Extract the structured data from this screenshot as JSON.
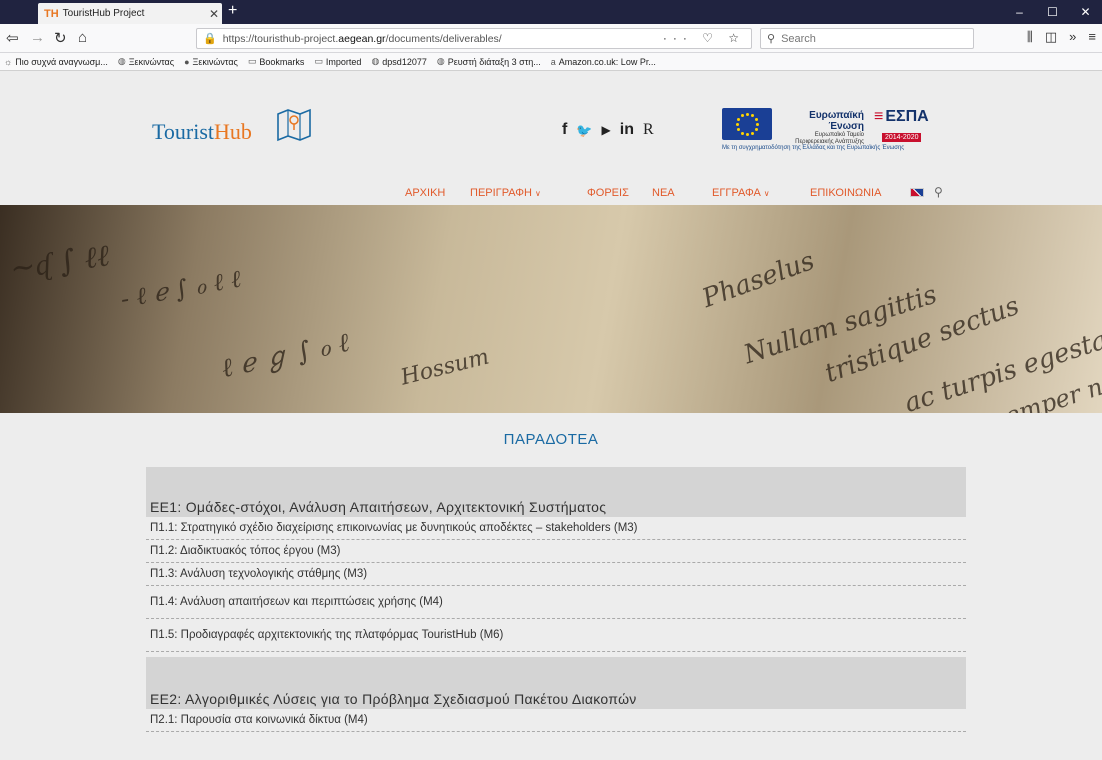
{
  "browser": {
    "tab_title": "TouristHub Project",
    "tab_icon_text": "TH",
    "url_prefix": "https://touristhub-project.",
    "url_host": "aegean.gr",
    "url_path": "/documents/deliverables/",
    "url_actions": "··· ♡ ☆",
    "search_placeholder": "Search",
    "bookmarks": [
      {
        "label": "Πιο συχνά αναγνωσμ...",
        "icon": "gear-icon"
      },
      {
        "label": "Ξεκινώντας",
        "icon": "globe-icon"
      },
      {
        "label": "Ξεκινώντας",
        "icon": "firefox-icon"
      },
      {
        "label": "Bookmarks",
        "icon": "folder-icon"
      },
      {
        "label": "Imported",
        "icon": "folder-icon"
      },
      {
        "label": "dpsd12077",
        "icon": "globe-icon"
      },
      {
        "label": "Ρευστή διάταξη 3 στη...",
        "icon": "globe-icon"
      },
      {
        "label": "Amazon.co.uk: Low Pr...",
        "icon": "amazon-icon"
      }
    ]
  },
  "site": {
    "logo_tourist": "Tourist",
    "logo_hub": "Hub",
    "social": [
      "f",
      "🐦",
      "▶",
      "in",
      "R"
    ],
    "eu_title": "Ευρωπαϊκή Ένωση",
    "eu_sub1": "Ευρωπαϊκό Ταμείο",
    "eu_sub2": "Περιφερειακής Ανάπτυξης",
    "espa_label": "ΕΣΠΑ",
    "espa_years": "2014-2020",
    "cofund_text": "Με τη συγχρηματοδότηση της Ελλάδας και της Ευρωπαϊκής Ένωσης",
    "nav": [
      {
        "label": "ΑΡΧΙΚΗ",
        "dropdown": false
      },
      {
        "label": "ΠΕΡΙΓΡΑΦΗ",
        "dropdown": true
      },
      {
        "label": "ΦΟΡΕΙΣ",
        "dropdown": false
      },
      {
        "label": "ΝΕΑ",
        "dropdown": false
      },
      {
        "label": "ΕΓΓΡΑΦΑ",
        "dropdown": true
      },
      {
        "label": "ΕΠΙΚΟΙΝΩΝΙΑ",
        "dropdown": false
      }
    ],
    "hero_script": [
      "Phaselus",
      "tristique sectus",
      "ac turpis egestas",
      "Nullam sagittis",
      "et semper nec",
      "Hossum"
    ],
    "page_title": "ΠΑΡΑΔΟΤΕΑ",
    "work_packages": [
      {
        "title": "ΕΕ1: Ομάδες-στόχοι, Ανάλυση Απαιτήσεων, Αρχιτεκτονική Συστήματος",
        "deliverables": [
          "Π1.1: Στρατηγικό σχέδιο διαχείρισης επικοινωνίας με δυνητικούς αποδέκτες – stakeholders (Μ3)",
          "Π1.2: Διαδικτυακός τόπος έργου (Μ3)",
          "Π1.3: Ανάλυση τεχνολογικής στάθμης (Μ3)",
          "Π1.4: Ανάλυση απαιτήσεων και περιπτώσεις χρήσης (Μ4)",
          "Π1.5: Προδιαγραφές αρχιτεκτονικής της πλατφόρμας TouristHub (Μ6)"
        ]
      },
      {
        "title": "ΕΕ2: Αλγοριθμικές Λύσεις για το Πρόβλημα Σχεδιασμού Πακέτου Διακοπών",
        "deliverables": [
          "Π2.1: Παρουσία στα κοινωνικά δίκτυα (Μ4)"
        ]
      }
    ]
  }
}
